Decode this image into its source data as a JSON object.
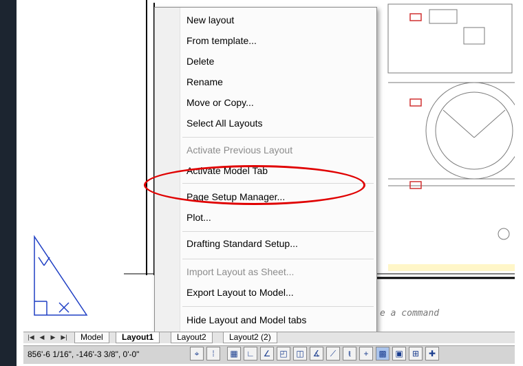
{
  "menu": {
    "items": [
      {
        "label": "New layout",
        "enabled": true
      },
      {
        "label": "From template...",
        "enabled": true
      },
      {
        "label": "Delete",
        "enabled": true
      },
      {
        "label": "Rename",
        "enabled": true
      },
      {
        "label": "Move or Copy...",
        "enabled": true
      },
      {
        "label": "Select All Layouts",
        "enabled": true
      },
      {
        "label": "Activate Previous Layout",
        "enabled": false
      },
      {
        "label": "Activate Model Tab",
        "enabled": true
      },
      {
        "label": "Page Setup Manager...",
        "enabled": true,
        "highlighted": true
      },
      {
        "label": "Plot...",
        "enabled": true
      },
      {
        "label": "Drafting Standard Setup...",
        "enabled": true
      },
      {
        "label": "Import Layout as Sheet...",
        "enabled": false
      },
      {
        "label": "Export Layout to Model...",
        "enabled": true
      },
      {
        "label": "Hide Layout and Model tabs",
        "enabled": true
      }
    ]
  },
  "command_line": {
    "placeholder": "e a command"
  },
  "tabs": {
    "nav": [
      "|◀",
      "◀",
      "▶",
      "▶|"
    ],
    "model": "Model",
    "layout1": "Layout1",
    "layout2": "Layout2",
    "layout2_copy": "Layout2 (2)"
  },
  "status": {
    "coordinates": "856'-6 1/16\", -146'-3 3/8\", 0'-0\""
  },
  "colors": {
    "highlight_ellipse": "#e00000",
    "ucs_icon": "#1f3fc4"
  }
}
